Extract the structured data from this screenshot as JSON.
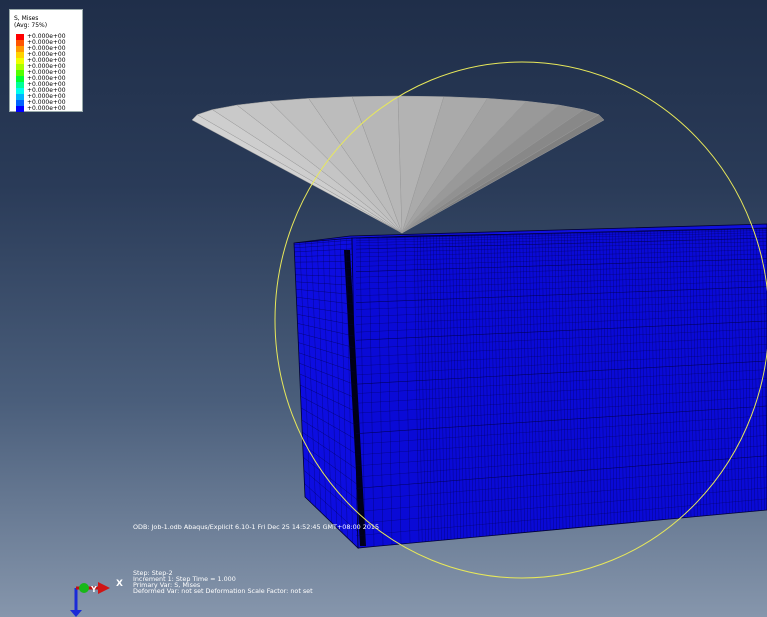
{
  "legend": {
    "title": "S, Mises",
    "subtitle": "(Avg: 75%)",
    "values": [
      "+0.000e+00",
      "+0.000e+00",
      "+0.000e+00",
      "+0.000e+00",
      "+0.000e+00",
      "+0.000e+00",
      "+0.000e+00",
      "+0.000e+00",
      "+0.000e+00",
      "+0.000e+00",
      "+0.000e+00",
      "+0.000e+00",
      "+0.000e+00"
    ],
    "colors": [
      "#ff0000",
      "#ff5500",
      "#ff9900",
      "#ffd200",
      "#f0ff00",
      "#aaff00",
      "#55ff00",
      "#00ff33",
      "#00ff99",
      "#00ffee",
      "#00b4ff",
      "#0064ff",
      "#0000ff"
    ]
  },
  "odb_line": "ODB: Job-1.odb    Abaqus/Explicit 6.10-1    Fri Dec 25 14:52:45 GMT+08:00 2015",
  "step_info": {
    "step": "Step: Step-2",
    "increment": "Increment      1: Step Time =    1.000",
    "primary_var": "Primary Var: S, Mises",
    "deformed": "Deformed Var: not set   Deformation Scale Factor: not set"
  },
  "triad": {
    "x": "X",
    "y": "Y",
    "z": "Z"
  },
  "colors": {
    "mesh_fill": "#0a0ad6",
    "mesh_line": "#000044",
    "indenter": "#c8c8c8",
    "circle": "#e8e85a"
  }
}
